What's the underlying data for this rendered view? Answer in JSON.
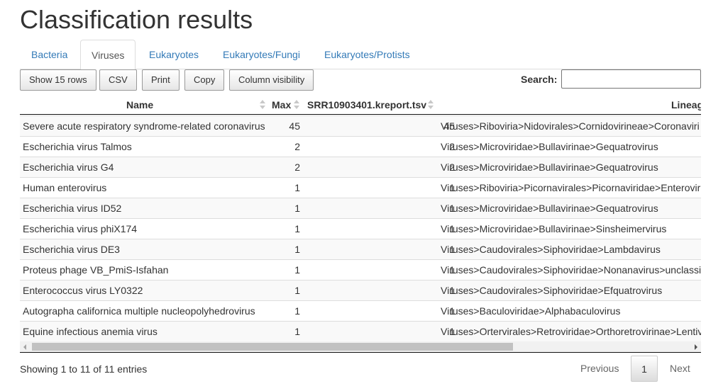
{
  "page": {
    "title": "Classification results"
  },
  "tabs": [
    {
      "label": "Bacteria"
    },
    {
      "label": "Viruses",
      "active": true
    },
    {
      "label": "Eukaryotes"
    },
    {
      "label": "Eukaryotes/Fungi"
    },
    {
      "label": "Eukaryotes/Protists"
    }
  ],
  "buttons": {
    "show_rows": "Show 15 rows",
    "csv": "CSV",
    "print": "Print",
    "copy": "Copy",
    "column_visibility": "Column visibility"
  },
  "search": {
    "label": "Search:",
    "value": ""
  },
  "table": {
    "columns": [
      "Name",
      "Max",
      "SRR10903401.kreport.tsv",
      "Lineag"
    ],
    "rows": [
      {
        "name": "Severe acute respiratory syndrome-related coronavirus",
        "max": "45",
        "srr": "45",
        "lineage": "Viruses>Riboviria>Nidovirales>Cornidovirineae>Coronaviri"
      },
      {
        "name": "Escherichia virus Talmos",
        "max": "2",
        "srr": "2",
        "lineage": "Viruses>Microviridae>Bullavirinae>Gequatrovirus"
      },
      {
        "name": "Escherichia virus G4",
        "max": "2",
        "srr": "2",
        "lineage": "Viruses>Microviridae>Bullavirinae>Gequatrovirus"
      },
      {
        "name": "Human enterovirus",
        "max": "1",
        "srr": "1",
        "lineage": "Viruses>Riboviria>Picornavirales>Picornaviridae>Enterovir"
      },
      {
        "name": "Escherichia virus ID52",
        "max": "1",
        "srr": "1",
        "lineage": "Viruses>Microviridae>Bullavirinae>Gequatrovirus"
      },
      {
        "name": "Escherichia virus phiX174",
        "max": "1",
        "srr": "1",
        "lineage": "Viruses>Microviridae>Bullavirinae>Sinsheimervirus"
      },
      {
        "name": "Escherichia virus DE3",
        "max": "1",
        "srr": "1",
        "lineage": "Viruses>Caudovirales>Siphoviridae>Lambdavirus"
      },
      {
        "name": "Proteus phage VB_PmiS-Isfahan",
        "max": "1",
        "srr": "1",
        "lineage": "Viruses>Caudovirales>Siphoviridae>Nonanavirus>unclassi"
      },
      {
        "name": "Enterococcus virus LY0322",
        "max": "1",
        "srr": "1",
        "lineage": "Viruses>Caudovirales>Siphoviridae>Efquatrovirus"
      },
      {
        "name": "Autographa californica multiple nucleopolyhedrovirus",
        "max": "1",
        "srr": "1",
        "lineage": "Viruses>Baculoviridae>Alphabaculovirus"
      },
      {
        "name": "Equine infectious anemia virus",
        "max": "1",
        "srr": "1",
        "lineage": "Viruses>Ortervirales>Retroviridae>Orthoretrovirinae>Lentiv"
      }
    ]
  },
  "footer": {
    "info": "Showing 1 to 11 of 11 entries",
    "previous": "Previous",
    "page": "1",
    "next": "Next"
  },
  "colors": {
    "link": "#337ab7",
    "row_stripe": "#f9f9f9"
  }
}
